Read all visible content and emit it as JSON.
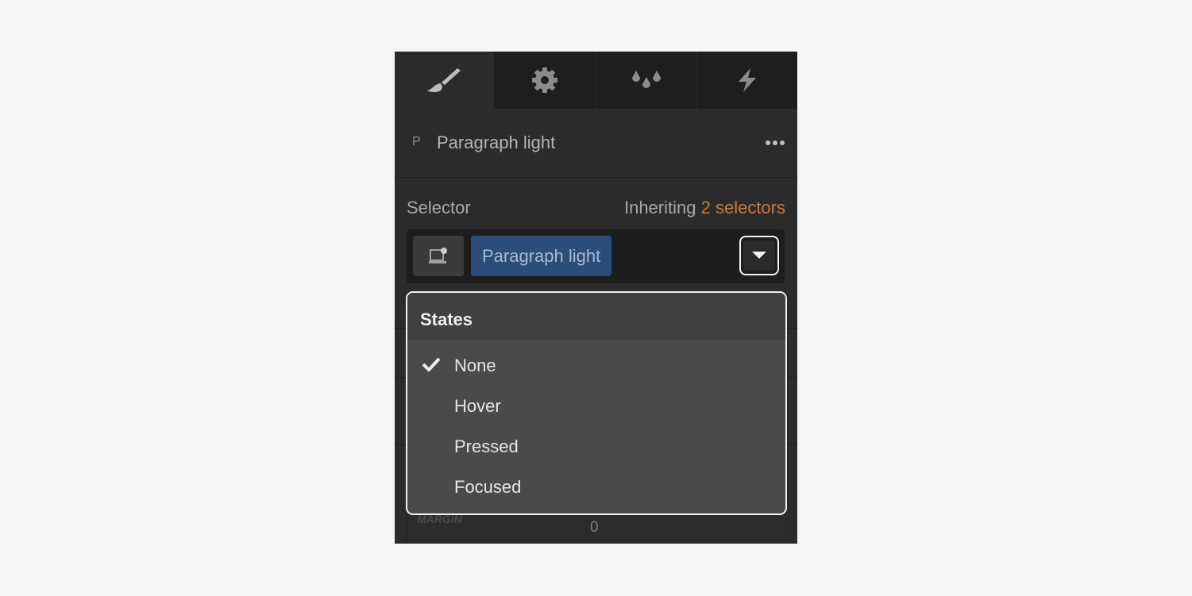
{
  "tabs": [
    {
      "icon": "paintbrush-icon",
      "active": true
    },
    {
      "icon": "gear-icon",
      "active": false
    },
    {
      "icon": "droplets-icon",
      "active": false
    },
    {
      "icon": "lightning-icon",
      "active": false
    }
  ],
  "element": {
    "tag": "P",
    "name": "Paragraph light"
  },
  "selector": {
    "label": "Selector",
    "inheriting_prefix": "Inheriting",
    "inheriting_count": "2 selectors",
    "chip": "Paragraph light"
  },
  "states": {
    "title": "States",
    "items": [
      {
        "label": "None",
        "checked": true
      },
      {
        "label": "Hover",
        "checked": false
      },
      {
        "label": "Pressed",
        "checked": false
      },
      {
        "label": "Focused",
        "checked": false
      }
    ]
  },
  "margin": {
    "label": "MARGIN",
    "value": "0"
  },
  "colors": {
    "accent_orange": "#c27c45",
    "chip_blue": "#2c4c79"
  }
}
